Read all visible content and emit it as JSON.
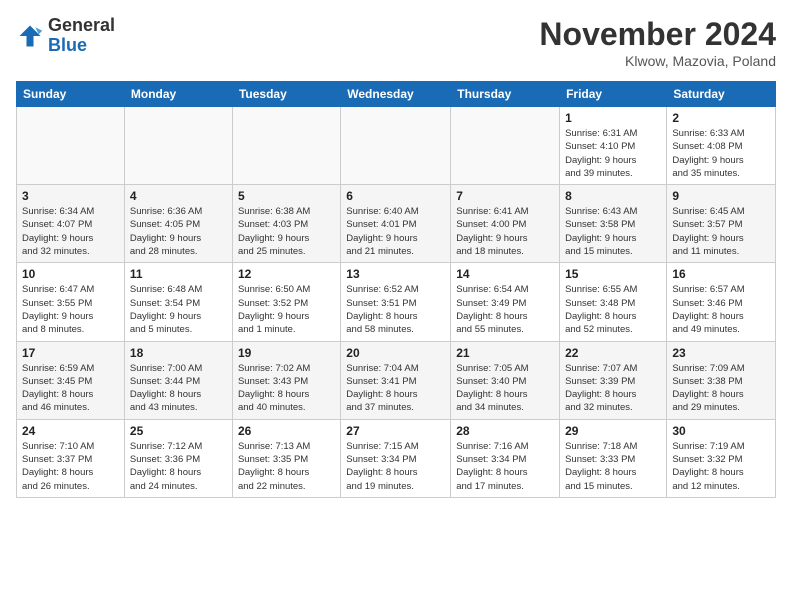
{
  "logo": {
    "general": "General",
    "blue": "Blue"
  },
  "title": "November 2024",
  "location": "Klwow, Mazovia, Poland",
  "headers": [
    "Sunday",
    "Monday",
    "Tuesday",
    "Wednesday",
    "Thursday",
    "Friday",
    "Saturday"
  ],
  "weeks": [
    [
      {
        "day": "",
        "detail": ""
      },
      {
        "day": "",
        "detail": ""
      },
      {
        "day": "",
        "detail": ""
      },
      {
        "day": "",
        "detail": ""
      },
      {
        "day": "",
        "detail": ""
      },
      {
        "day": "1",
        "detail": "Sunrise: 6:31 AM\nSunset: 4:10 PM\nDaylight: 9 hours\nand 39 minutes."
      },
      {
        "day": "2",
        "detail": "Sunrise: 6:33 AM\nSunset: 4:08 PM\nDaylight: 9 hours\nand 35 minutes."
      }
    ],
    [
      {
        "day": "3",
        "detail": "Sunrise: 6:34 AM\nSunset: 4:07 PM\nDaylight: 9 hours\nand 32 minutes."
      },
      {
        "day": "4",
        "detail": "Sunrise: 6:36 AM\nSunset: 4:05 PM\nDaylight: 9 hours\nand 28 minutes."
      },
      {
        "day": "5",
        "detail": "Sunrise: 6:38 AM\nSunset: 4:03 PM\nDaylight: 9 hours\nand 25 minutes."
      },
      {
        "day": "6",
        "detail": "Sunrise: 6:40 AM\nSunset: 4:01 PM\nDaylight: 9 hours\nand 21 minutes."
      },
      {
        "day": "7",
        "detail": "Sunrise: 6:41 AM\nSunset: 4:00 PM\nDaylight: 9 hours\nand 18 minutes."
      },
      {
        "day": "8",
        "detail": "Sunrise: 6:43 AM\nSunset: 3:58 PM\nDaylight: 9 hours\nand 15 minutes."
      },
      {
        "day": "9",
        "detail": "Sunrise: 6:45 AM\nSunset: 3:57 PM\nDaylight: 9 hours\nand 11 minutes."
      }
    ],
    [
      {
        "day": "10",
        "detail": "Sunrise: 6:47 AM\nSunset: 3:55 PM\nDaylight: 9 hours\nand 8 minutes."
      },
      {
        "day": "11",
        "detail": "Sunrise: 6:48 AM\nSunset: 3:54 PM\nDaylight: 9 hours\nand 5 minutes."
      },
      {
        "day": "12",
        "detail": "Sunrise: 6:50 AM\nSunset: 3:52 PM\nDaylight: 9 hours\nand 1 minute."
      },
      {
        "day": "13",
        "detail": "Sunrise: 6:52 AM\nSunset: 3:51 PM\nDaylight: 8 hours\nand 58 minutes."
      },
      {
        "day": "14",
        "detail": "Sunrise: 6:54 AM\nSunset: 3:49 PM\nDaylight: 8 hours\nand 55 minutes."
      },
      {
        "day": "15",
        "detail": "Sunrise: 6:55 AM\nSunset: 3:48 PM\nDaylight: 8 hours\nand 52 minutes."
      },
      {
        "day": "16",
        "detail": "Sunrise: 6:57 AM\nSunset: 3:46 PM\nDaylight: 8 hours\nand 49 minutes."
      }
    ],
    [
      {
        "day": "17",
        "detail": "Sunrise: 6:59 AM\nSunset: 3:45 PM\nDaylight: 8 hours\nand 46 minutes."
      },
      {
        "day": "18",
        "detail": "Sunrise: 7:00 AM\nSunset: 3:44 PM\nDaylight: 8 hours\nand 43 minutes."
      },
      {
        "day": "19",
        "detail": "Sunrise: 7:02 AM\nSunset: 3:43 PM\nDaylight: 8 hours\nand 40 minutes."
      },
      {
        "day": "20",
        "detail": "Sunrise: 7:04 AM\nSunset: 3:41 PM\nDaylight: 8 hours\nand 37 minutes."
      },
      {
        "day": "21",
        "detail": "Sunrise: 7:05 AM\nSunset: 3:40 PM\nDaylight: 8 hours\nand 34 minutes."
      },
      {
        "day": "22",
        "detail": "Sunrise: 7:07 AM\nSunset: 3:39 PM\nDaylight: 8 hours\nand 32 minutes."
      },
      {
        "day": "23",
        "detail": "Sunrise: 7:09 AM\nSunset: 3:38 PM\nDaylight: 8 hours\nand 29 minutes."
      }
    ],
    [
      {
        "day": "24",
        "detail": "Sunrise: 7:10 AM\nSunset: 3:37 PM\nDaylight: 8 hours\nand 26 minutes."
      },
      {
        "day": "25",
        "detail": "Sunrise: 7:12 AM\nSunset: 3:36 PM\nDaylight: 8 hours\nand 24 minutes."
      },
      {
        "day": "26",
        "detail": "Sunrise: 7:13 AM\nSunset: 3:35 PM\nDaylight: 8 hours\nand 22 minutes."
      },
      {
        "day": "27",
        "detail": "Sunrise: 7:15 AM\nSunset: 3:34 PM\nDaylight: 8 hours\nand 19 minutes."
      },
      {
        "day": "28",
        "detail": "Sunrise: 7:16 AM\nSunset: 3:34 PM\nDaylight: 8 hours\nand 17 minutes."
      },
      {
        "day": "29",
        "detail": "Sunrise: 7:18 AM\nSunset: 3:33 PM\nDaylight: 8 hours\nand 15 minutes."
      },
      {
        "day": "30",
        "detail": "Sunrise: 7:19 AM\nSunset: 3:32 PM\nDaylight: 8 hours\nand 12 minutes."
      }
    ]
  ]
}
